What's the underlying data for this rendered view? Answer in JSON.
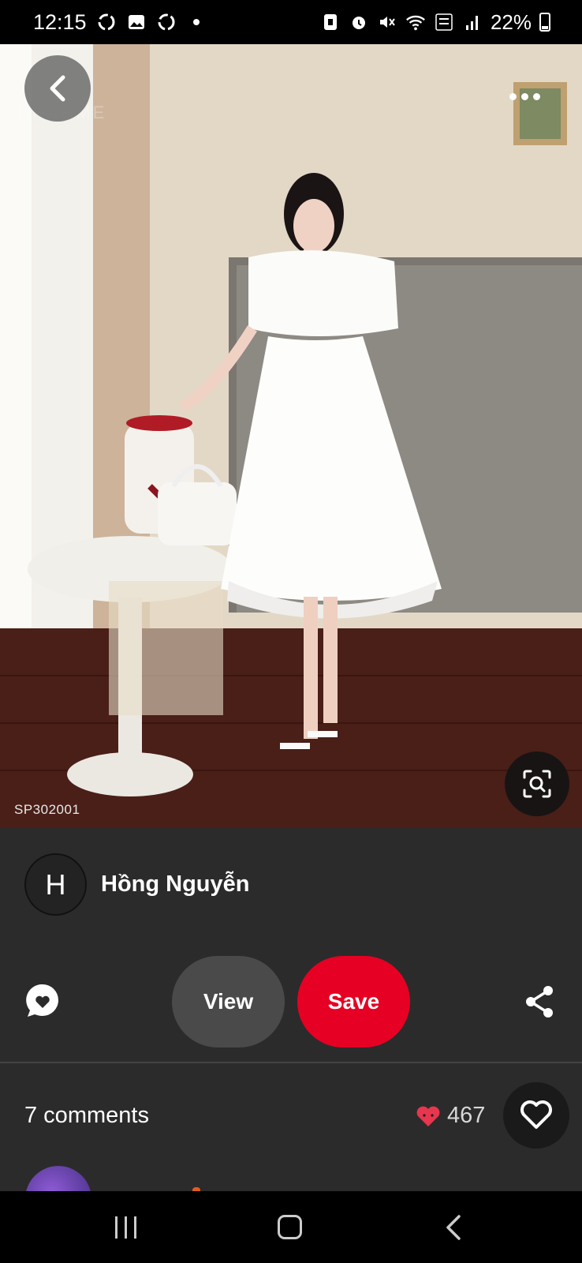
{
  "status_bar": {
    "time": "12:15",
    "battery": "22%",
    "left_icons": [
      "sync-icon",
      "gallery-icon",
      "sync-icon",
      "dot-icon"
    ],
    "right_icons": [
      "save-icon",
      "alarm-icon",
      "mute-icon",
      "wifi-icon",
      "volte-icon",
      "signal-icon",
      "battery-icon"
    ]
  },
  "pin": {
    "sku_label": "SP302001"
  },
  "author": {
    "initial": "H",
    "name": "Hồng Nguyễn"
  },
  "actions": {
    "view_label": "View",
    "save_label": "Save"
  },
  "comments": {
    "count_label": "7 comments",
    "reaction_count": "467"
  },
  "colors": {
    "save_red": "#e60023",
    "panel_bg": "#2b2b2b",
    "view_bg": "#4a4a4a",
    "reaction_heart": "#e8364f"
  }
}
